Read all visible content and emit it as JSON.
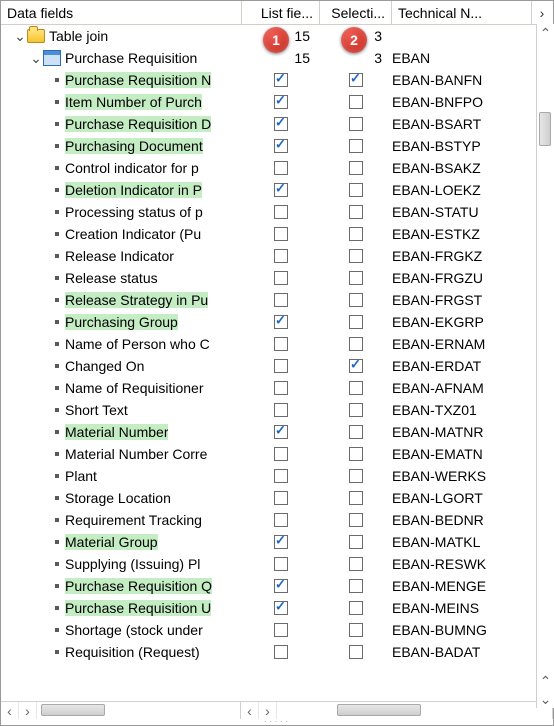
{
  "columns": {
    "data": "Data fields",
    "list": "List fie...",
    "sel": "Selecti...",
    "tech": "Technical N..."
  },
  "badges": {
    "b1": "1",
    "b2": "2"
  },
  "tree": {
    "root": {
      "label": "Table join",
      "list_count": "15",
      "sel_count": "3"
    },
    "node": {
      "label": "Purchase Requisition",
      "list_count": "15",
      "sel_count": "3",
      "tech": "EBAN"
    }
  },
  "fields": [
    {
      "label": "Purchase Requisition N",
      "hl": true,
      "list": true,
      "sel": true,
      "tech": "EBAN-BANFN"
    },
    {
      "label": "Item Number of Purch",
      "hl": true,
      "list": true,
      "sel": false,
      "tech": "EBAN-BNFPO"
    },
    {
      "label": "Purchase Requisition D",
      "hl": true,
      "list": true,
      "sel": false,
      "tech": "EBAN-BSART"
    },
    {
      "label": "Purchasing Document",
      "hl": true,
      "list": true,
      "sel": false,
      "tech": "EBAN-BSTYP"
    },
    {
      "label": "Control indicator for p",
      "hl": false,
      "list": false,
      "sel": false,
      "tech": "EBAN-BSAKZ"
    },
    {
      "label": "Deletion Indicator in P",
      "hl": true,
      "list": true,
      "sel": false,
      "tech": "EBAN-LOEKZ"
    },
    {
      "label": "Processing status of p",
      "hl": false,
      "list": false,
      "sel": false,
      "tech": "EBAN-STATU"
    },
    {
      "label": "Creation Indicator (Pu",
      "hl": false,
      "list": false,
      "sel": false,
      "tech": "EBAN-ESTKZ"
    },
    {
      "label": "Release Indicator",
      "hl": false,
      "list": false,
      "sel": false,
      "tech": "EBAN-FRGKZ"
    },
    {
      "label": "Release status",
      "hl": false,
      "list": false,
      "sel": false,
      "tech": "EBAN-FRGZU"
    },
    {
      "label": "Release Strategy in Pu",
      "hl": true,
      "list": false,
      "sel": false,
      "tech": "EBAN-FRGST"
    },
    {
      "label": "Purchasing Group",
      "hl": true,
      "list": true,
      "sel": false,
      "tech": "EBAN-EKGRP"
    },
    {
      "label": "Name of Person who C",
      "hl": false,
      "list": false,
      "sel": false,
      "tech": "EBAN-ERNAM"
    },
    {
      "label": "Changed On",
      "hl": false,
      "list": false,
      "sel": true,
      "tech": "EBAN-ERDAT"
    },
    {
      "label": "Name of Requisitioner",
      "hl": false,
      "list": false,
      "sel": false,
      "tech": "EBAN-AFNAM"
    },
    {
      "label": "Short Text",
      "hl": false,
      "list": false,
      "sel": false,
      "tech": "EBAN-TXZ01"
    },
    {
      "label": "Material Number",
      "hl": true,
      "list": true,
      "sel": false,
      "tech": "EBAN-MATNR"
    },
    {
      "label": "Material Number Corre",
      "hl": false,
      "list": false,
      "sel": false,
      "tech": "EBAN-EMATN"
    },
    {
      "label": "Plant",
      "hl": false,
      "list": false,
      "sel": false,
      "tech": "EBAN-WERKS"
    },
    {
      "label": "Storage Location",
      "hl": false,
      "list": false,
      "sel": false,
      "tech": "EBAN-LGORT"
    },
    {
      "label": "Requirement Tracking",
      "hl": false,
      "list": false,
      "sel": false,
      "tech": "EBAN-BEDNR"
    },
    {
      "label": "Material Group",
      "hl": true,
      "list": true,
      "sel": false,
      "tech": "EBAN-MATKL"
    },
    {
      "label": "Supplying (Issuing) Pl",
      "hl": false,
      "list": false,
      "sel": false,
      "tech": "EBAN-RESWK"
    },
    {
      "label": "Purchase Requisition Q",
      "hl": true,
      "list": true,
      "sel": false,
      "tech": "EBAN-MENGE"
    },
    {
      "label": "Purchase Requisition U",
      "hl": true,
      "list": true,
      "sel": false,
      "tech": "EBAN-MEINS"
    },
    {
      "label": "Shortage (stock under",
      "hl": false,
      "list": false,
      "sel": false,
      "tech": "EBAN-BUMNG"
    },
    {
      "label": "Requisition (Request)",
      "hl": false,
      "list": false,
      "sel": false,
      "tech": "EBAN-BADAT"
    }
  ]
}
